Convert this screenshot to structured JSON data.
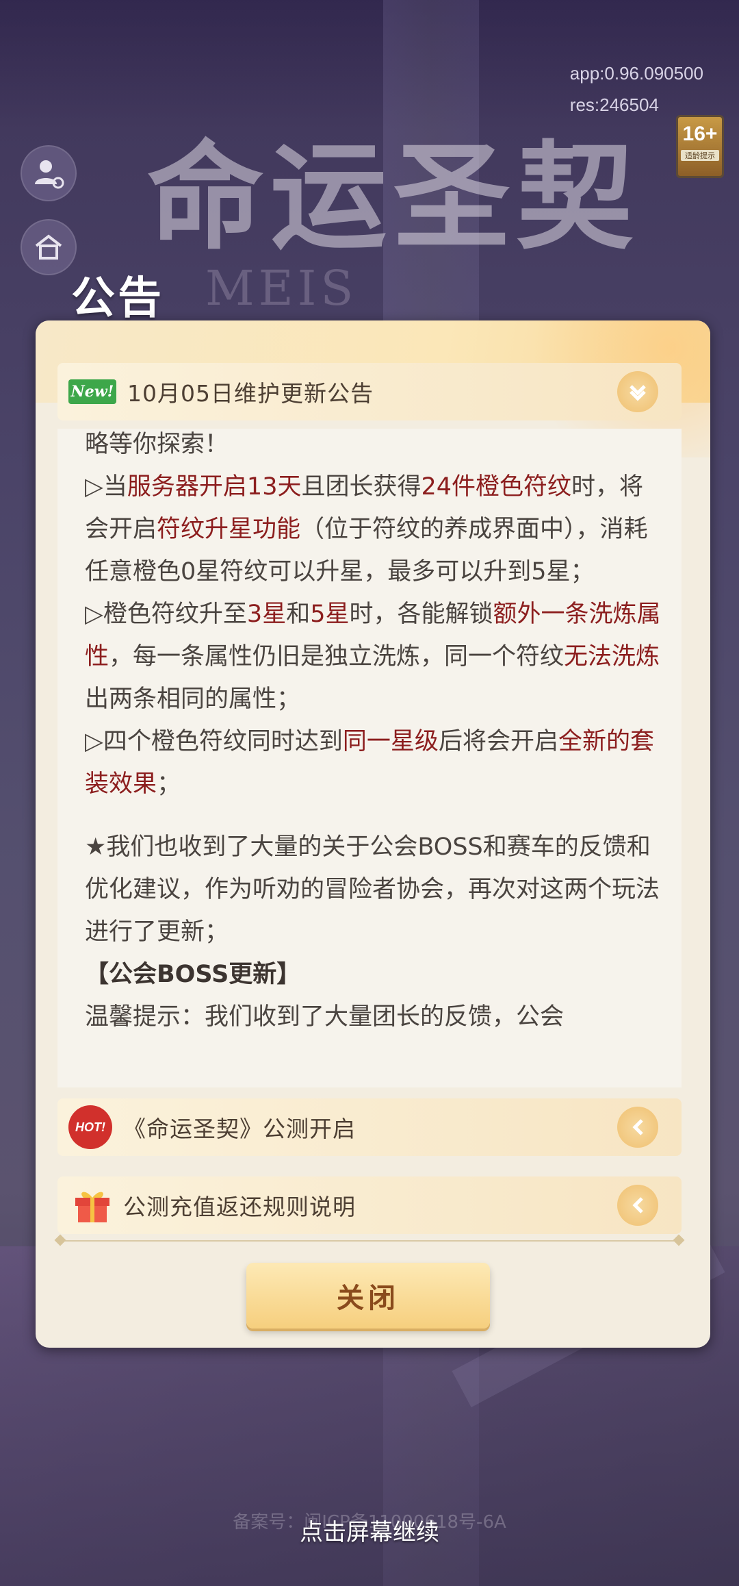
{
  "version": {
    "app": "app:0.96.090500",
    "res": "res:246504"
  },
  "age_rating": {
    "label": "16+",
    "sub": "适龄提示"
  },
  "logo": {
    "text": "命运圣契",
    "sub": "MEIS"
  },
  "notice_title": "公告",
  "items": {
    "active": {
      "tag": "New!",
      "label": "10月05日维护更新公告"
    },
    "second": {
      "tag": "HOT!",
      "label": "《命运圣契》公测开启"
    },
    "third": {
      "label": "公测充值返还规则说明"
    }
  },
  "content": {
    "p1": "略等你探索！",
    "p2": {
      "a": "▷当",
      "b": "服务器开启13天",
      "c": "且团长获得",
      "d": "24件橙色符纹",
      "e": "时，将会开启",
      "f": "符纹升星功能",
      "g": "（位于符纹的养成界面中），消耗任意橙色0星符纹可以升星，最多可以升到5星；"
    },
    "p3": {
      "a": "▷橙色符纹升至",
      "b": "3星",
      "c": "和",
      "d": "5星",
      "e": "时，各能解锁",
      "f": "额外一条洗炼属性",
      "g": "，每一条属性仍旧是独立洗炼，同一个符纹",
      "h": "无法洗炼",
      "i": "出两条相同的属性；"
    },
    "p4": {
      "a": "▷四个橙色符纹同时达到",
      "b": "同一星级",
      "c": "后将会开启",
      "d": "全新的套装效果",
      "e": "；"
    },
    "p5": "★我们也收到了大量的关于公会BOSS和赛车的反馈和优化建议，作为听劝的冒险者协会，再次对这两个玩法进行了更新；",
    "p6": "【公会BOSS更新】",
    "p7": "温馨提示：我们收到了大量团长的反馈，公会"
  },
  "close_label": "关闭",
  "icp": "备案号：闽ICP备11000618号-6A",
  "continue_label": "点击屏幕继续"
}
